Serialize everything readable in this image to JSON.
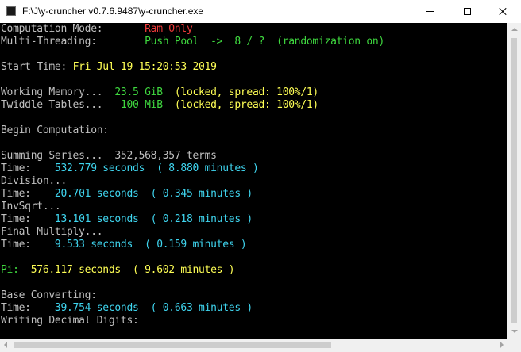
{
  "window": {
    "title": "F:\\J\\y-cruncher v0.7.6.9487\\y-cruncher.exe",
    "icon": "console-app-icon",
    "controls": {
      "minimize": "minimize-icon",
      "maximize": "maximize-icon",
      "close": "close-icon"
    }
  },
  "colors": {
    "console_bg": "#000000",
    "text_default": "#c0c0c0",
    "text_yellow": "#ffff55",
    "text_cyan": "#3fd5ef",
    "text_green": "#3fd83f",
    "text_red": "#ef3a3a"
  },
  "console": {
    "lines": [
      {
        "segments": [
          {
            "t": "Computation Mode:       ",
            "c": "w"
          },
          {
            "t": "Ram Only",
            "c": "r"
          }
        ]
      },
      {
        "segments": [
          {
            "t": "Multi-Threading:        ",
            "c": "w"
          },
          {
            "t": "Push Pool  ->  8 / ?  (randomization on)",
            "c": "g"
          }
        ]
      },
      {
        "segments": []
      },
      {
        "segments": [
          {
            "t": "Start Time: ",
            "c": "w"
          },
          {
            "t": "Fri Jul 19 15:20:53 2019",
            "c": "y"
          }
        ]
      },
      {
        "segments": []
      },
      {
        "segments": [
          {
            "t": "Working Memory...  ",
            "c": "w"
          },
          {
            "t": "23.5 GiB",
            "c": "g"
          },
          {
            "t": "  (locked, spread: 100%/1)",
            "c": "y"
          }
        ]
      },
      {
        "segments": [
          {
            "t": "Twiddle Tables...   ",
            "c": "w"
          },
          {
            "t": "100 MiB",
            "c": "g"
          },
          {
            "t": "  (locked, spread: 100%/1)",
            "c": "y"
          }
        ]
      },
      {
        "segments": []
      },
      {
        "segments": [
          {
            "t": "Begin Computation:",
            "c": "w"
          }
        ]
      },
      {
        "segments": []
      },
      {
        "segments": [
          {
            "t": "Summing Series...  352,568,357 terms",
            "c": "w"
          }
        ]
      },
      {
        "segments": [
          {
            "t": "Time:    ",
            "c": "w"
          },
          {
            "t": "532.779 seconds  ( 8.880 minutes )",
            "c": "c"
          }
        ]
      },
      {
        "segments": [
          {
            "t": "Division...",
            "c": "w"
          }
        ]
      },
      {
        "segments": [
          {
            "t": "Time:    ",
            "c": "w"
          },
          {
            "t": "20.701 seconds  ( 0.345 minutes )",
            "c": "c"
          }
        ]
      },
      {
        "segments": [
          {
            "t": "InvSqrt...",
            "c": "w"
          }
        ]
      },
      {
        "segments": [
          {
            "t": "Time:    ",
            "c": "w"
          },
          {
            "t": "13.101 seconds  ( 0.218 minutes )",
            "c": "c"
          }
        ]
      },
      {
        "segments": [
          {
            "t": "Final Multiply...",
            "c": "w"
          }
        ]
      },
      {
        "segments": [
          {
            "t": "Time:    ",
            "c": "w"
          },
          {
            "t": "9.533 seconds  ( 0.159 minutes )",
            "c": "c"
          }
        ]
      },
      {
        "segments": []
      },
      {
        "segments": [
          {
            "t": "Pi:  ",
            "c": "g"
          },
          {
            "t": "576.117 seconds  ( 9.602 minutes )",
            "c": "y"
          }
        ]
      },
      {
        "segments": []
      },
      {
        "segments": [
          {
            "t": "Base Converting:",
            "c": "w"
          }
        ]
      },
      {
        "segments": [
          {
            "t": "Time:    ",
            "c": "w"
          },
          {
            "t": "39.754 seconds  ( 0.663 minutes )",
            "c": "c"
          }
        ]
      },
      {
        "segments": [
          {
            "t": "Writing Decimal Digits:",
            "c": "w"
          }
        ]
      }
    ]
  }
}
